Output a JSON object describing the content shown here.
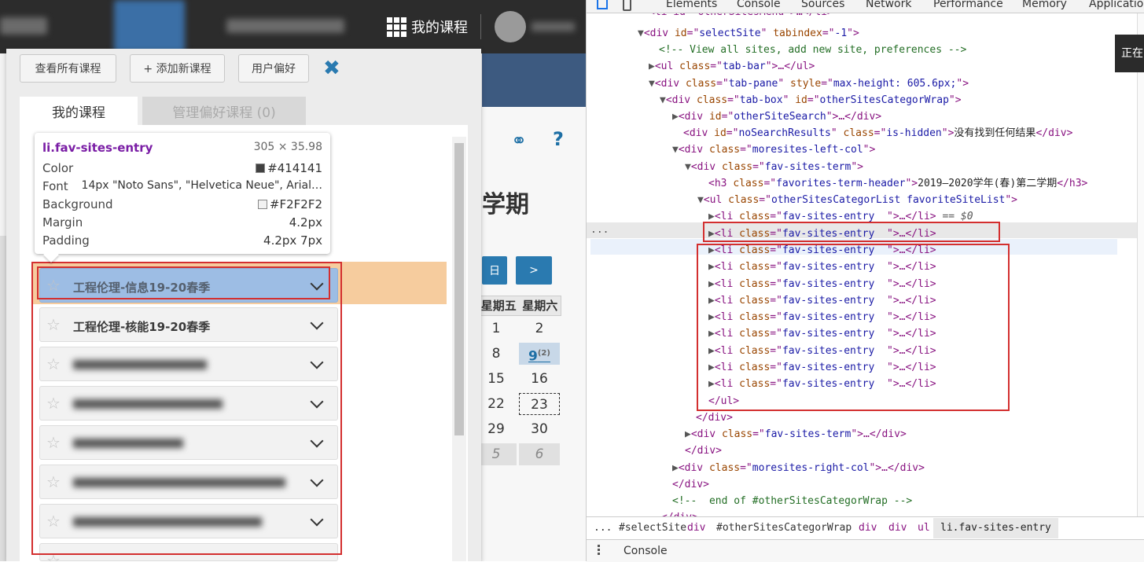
{
  "nav": {
    "my_courses": "我的课程"
  },
  "popup": {
    "btn_view_all": "查看所有课程",
    "btn_add_new": "+ 添加新课程",
    "btn_prefs": "用户偏好",
    "tab_my": "我的课程",
    "tab_pref": "管理偏好课程 (0)",
    "entries": [
      {
        "name": "工程伦理-信息19-20春季",
        "selected": true
      },
      {
        "name": "工程伦理-核能19-20春季",
        "selected": false
      },
      {
        "name": "",
        "selected": false
      },
      {
        "name": "",
        "selected": false
      },
      {
        "name": "",
        "selected": false
      },
      {
        "name": "",
        "selected": false
      },
      {
        "name": "",
        "selected": false
      }
    ]
  },
  "tooltip": {
    "title": "li.fav-sites-entry",
    "size": "305 × 35.98",
    "rows": [
      {
        "k": "Color",
        "v": "#414141",
        "swatch": "#414141"
      },
      {
        "k": "Font",
        "v": "14px \"Noto Sans\", \"Helvetica Neue\", Arial…"
      },
      {
        "k": "Background",
        "v": "#F2F2F2",
        "swatch": "#F2F2F2"
      },
      {
        "k": "Margin",
        "v": "4.2px"
      },
      {
        "k": "Padding",
        "v": "4.2px 7px"
      }
    ]
  },
  "background": {
    "term_fragment": "学期",
    "cal_today": "日",
    "cal_next": ">",
    "weekdays": [
      "星期五",
      "星期六"
    ],
    "cells": [
      "1",
      "2",
      "8",
      "9",
      "15",
      "16",
      "22",
      "23",
      "29",
      "30",
      "5",
      "6"
    ],
    "badge": "(2)"
  },
  "devtools": {
    "tabs": [
      "Elements",
      "Console",
      "Sources",
      "Network",
      "Performance",
      "Memory",
      "Application"
    ],
    "equals_marker": "== $0",
    "breadcrumbs": [
      "...",
      "#selectSite",
      "div",
      "#otherSitesCategorWrap",
      "div",
      "div",
      "ul",
      "li.fav-sites-entry"
    ],
    "console_label": "Console",
    "toast": "正在"
  }
}
